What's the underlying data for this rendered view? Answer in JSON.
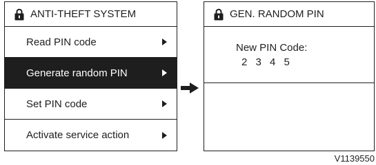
{
  "left_screen": {
    "title": "ANTI-THEFT SYSTEM",
    "menu_items": [
      {
        "label": "Read PIN code"
      },
      {
        "label": "Generate random PIN"
      },
      {
        "label": "Set PIN code"
      },
      {
        "label": "Activate service action"
      }
    ],
    "selected_index": 1
  },
  "right_screen": {
    "title": "GEN. RANDOM PIN",
    "prompt": "New PIN Code:",
    "pin": "2 3 4 5"
  },
  "icons": {
    "title_icon": "lock-icon",
    "item_indicator": "triangle-right-icon",
    "navigation": "arrow-right-icon"
  },
  "reference_code": "V1139550"
}
